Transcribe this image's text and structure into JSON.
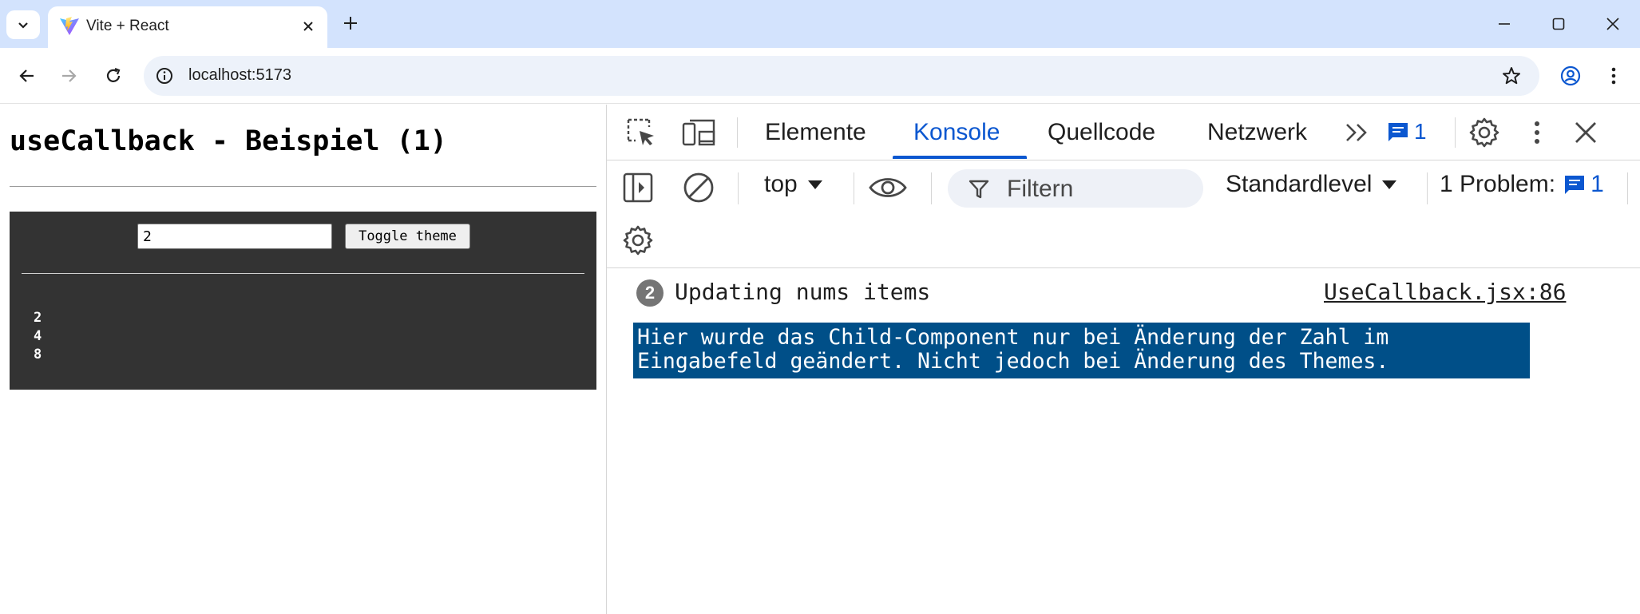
{
  "browser": {
    "tab_title": "Vite + React",
    "url": "localhost:5173"
  },
  "page": {
    "heading": "useCallback - Beispiel (1)",
    "number_input_value": "2",
    "toggle_button_label": "Toggle theme",
    "items": [
      "2",
      "4",
      "8"
    ],
    "panel_color": "#333333"
  },
  "devtools": {
    "tabs": [
      {
        "label": "Elemente",
        "active": false
      },
      {
        "label": "Konsole",
        "active": true
      },
      {
        "label": "Quellcode",
        "active": false
      },
      {
        "label": "Netzwerk",
        "active": false
      }
    ],
    "issue_badge_count": "1",
    "context_select": "top",
    "filter_placeholder": "Filtern",
    "level_select": "Standardlevel",
    "issues_label": "1 Problem:",
    "issues_count": "1",
    "accent_color": "#0b57d0"
  },
  "console": {
    "log": {
      "repeat_count": "2",
      "text": "Updating nums items",
      "source": "UseCallback.jsx:86"
    },
    "styled_message": "Hier wurde das Child-Component nur bei Änderung der Zahl im\nEingabefeld geändert. Nicht jedoch bei Änderung des Themes.",
    "styled_message_bg": "#004f88"
  }
}
